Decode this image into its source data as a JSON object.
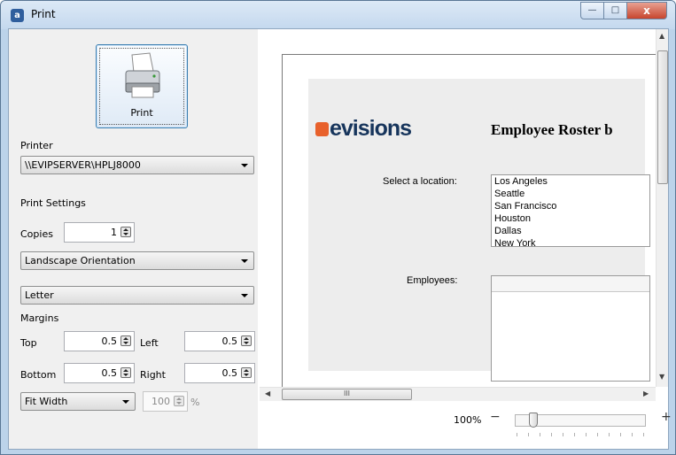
{
  "window": {
    "app_icon": "a",
    "title": "Print",
    "minimize_glyph": "—",
    "maximize_glyph": "□",
    "close_glyph": "x"
  },
  "left_panel": {
    "print_button_label": "Print",
    "printer_label": "Printer",
    "printer_value": "\\\\EVIPSERVER\\HPLJ8000",
    "print_settings_label": "Print Settings",
    "copies_label": "Copies",
    "copies_value": "1",
    "orientation_value": "Landscape Orientation",
    "paper_value": "Letter",
    "margins_label": "Margins",
    "top_label": "Top",
    "top_value": "0.5",
    "left_label": "Left",
    "left_value": "0.5",
    "bottom_label": "Bottom",
    "bottom_value": "0.5",
    "right_label": "Right",
    "right_value": "0.5",
    "scale_mode_value": "Fit Width",
    "scale_percent_value": "100",
    "percent_sign": "%"
  },
  "preview": {
    "logo_text": "evisions",
    "report_title": "Employee Roster b",
    "select_location_label": "Select a location:",
    "locations": [
      "Los Angeles",
      "Seattle",
      "San Francisco",
      "Houston",
      "Dallas",
      "New York"
    ],
    "employees_label": "Employees:",
    "hscroll_grip": "III"
  },
  "zoom": {
    "percent_label": "100%",
    "minus": "−",
    "plus": "+",
    "level": 0.1
  },
  "colors": {
    "logo_orange": "#e8612c",
    "logo_navy": "#17355c",
    "title_bar": "#c4d8ee"
  }
}
